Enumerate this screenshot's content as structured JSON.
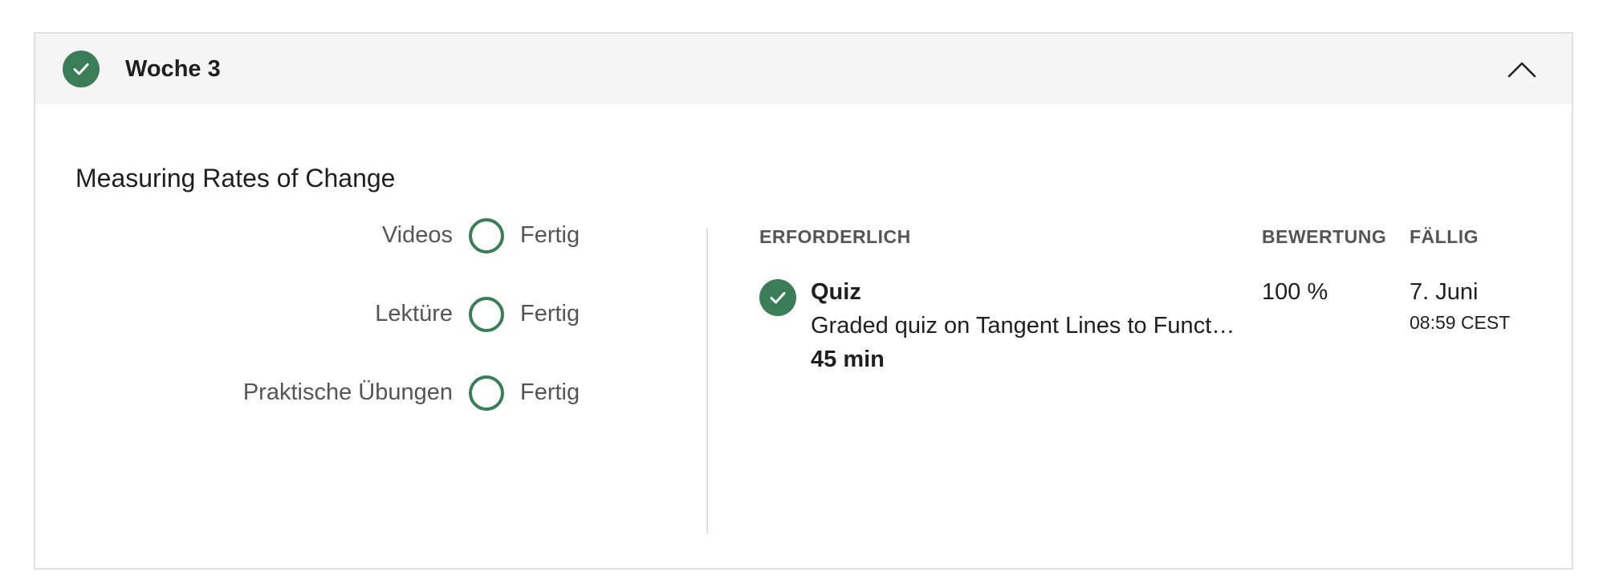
{
  "week": {
    "title": "Woche 3",
    "completed": true
  },
  "module": {
    "title": "Measuring Rates of Change"
  },
  "progress": [
    {
      "label": "Videos",
      "status": "Fertig"
    },
    {
      "label": "Lektüre",
      "status": "Fertig"
    },
    {
      "label": "Praktische Übungen",
      "status": "Fertig"
    }
  ],
  "table": {
    "headers": {
      "required": "ERFORDERLICH",
      "grade": "BEWERTUNG",
      "due": "FÄLLIG"
    },
    "items": [
      {
        "name": "Quiz",
        "description": "Graded quiz on Tangent Lines to Funct…",
        "duration": "45 min",
        "grade": "100 %",
        "due_date": "7. Juni",
        "due_time": "08:59 CEST",
        "completed": true
      }
    ]
  },
  "colors": {
    "accent_green": "#3a7d57",
    "header_bg": "#f5f5f5",
    "border": "#e1e1e1",
    "muted_text": "#555555"
  },
  "icons": {
    "week_status": "check-circle-icon",
    "collapse": "chevron-up-icon",
    "progress": "ring-icon",
    "item_status": "check-circle-icon"
  }
}
